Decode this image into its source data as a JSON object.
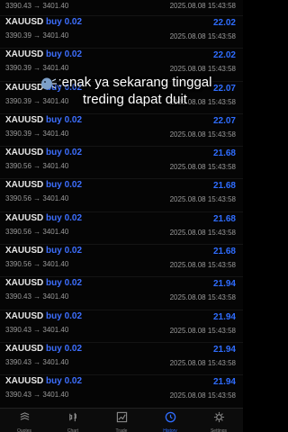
{
  "trades": [
    {
      "symbol": "",
      "side": "",
      "prices": "3390.43 → 3401.40",
      "profit": "",
      "time": "2025.08.08 15:43:58",
      "partial": true
    },
    {
      "symbol": "XAUUSD",
      "side": "buy 0.02",
      "prices": "3390.39 → 3401.40",
      "profit": "22.02",
      "time": "2025.08.08 15:43:58"
    },
    {
      "symbol": "XAUUSD",
      "side": "buy 0.02",
      "prices": "3390.39 → 3401.40",
      "profit": "22.02",
      "time": "2025.08.08 15:43:58"
    },
    {
      "symbol": "XAUUSD",
      "side": "buy 0.02",
      "prices": "3390.39 → 3401.40",
      "profit": "22.07",
      "time": "2025.08.08 15:43:58"
    },
    {
      "symbol": "XAUUSD",
      "side": "buy 0.02",
      "prices": "3390.39 → 3401.40",
      "profit": "22.07",
      "time": "2025.08.08 15:43:58"
    },
    {
      "symbol": "XAUUSD",
      "side": "buy 0.02",
      "prices": "3390.56 → 3401.40",
      "profit": "21.68",
      "time": "2025.08.08 15:43:58"
    },
    {
      "symbol": "XAUUSD",
      "side": "buy 0.02",
      "prices": "3390.56 → 3401.40",
      "profit": "21.68",
      "time": "2025.08.08 15:43:58"
    },
    {
      "symbol": "XAUUSD",
      "side": "buy 0.02",
      "prices": "3390.56 → 3401.40",
      "profit": "21.68",
      "time": "2025.08.08 15:43:58"
    },
    {
      "symbol": "XAUUSD",
      "side": "buy 0.02",
      "prices": "3390.56 → 3401.40",
      "profit": "21.68",
      "time": "2025.08.08 15:43:58"
    },
    {
      "symbol": "XAUUSD",
      "side": "buy 0.02",
      "prices": "3390.43 → 3401.40",
      "profit": "21.94",
      "time": "2025.08.08 15:43:58"
    },
    {
      "symbol": "XAUUSD",
      "side": "buy 0.02",
      "prices": "3390.43 → 3401.40",
      "profit": "21.94",
      "time": "2025.08.08 15:43:58"
    },
    {
      "symbol": "XAUUSD",
      "side": "buy 0.02",
      "prices": "3390.43 → 3401.40",
      "profit": "21.94",
      "time": "2025.08.08 15:43:58"
    },
    {
      "symbol": "XAUUSD",
      "side": "buy 0.02",
      "prices": "3390.43 → 3401.40",
      "profit": "21.94",
      "time": "2025.08.08 15:43:58"
    }
  ],
  "caption": {
    "text": ":enak ya sekarang tinggal treding dapat duit",
    "icon": "speaking-head-icon"
  },
  "nav": [
    {
      "label": "Quotes",
      "icon": "quotes-icon",
      "active": false
    },
    {
      "label": "Chart",
      "icon": "chart-icon",
      "active": false
    },
    {
      "label": "Trade",
      "icon": "trade-icon",
      "active": false
    },
    {
      "label": "History",
      "icon": "history-icon",
      "active": true
    },
    {
      "label": "Settings",
      "icon": "settings-icon",
      "active": false
    }
  ],
  "colors": {
    "accent": "#2f6dff",
    "background": "#050505",
    "text": "#e6e6e6",
    "muted": "#9a9a9a"
  }
}
